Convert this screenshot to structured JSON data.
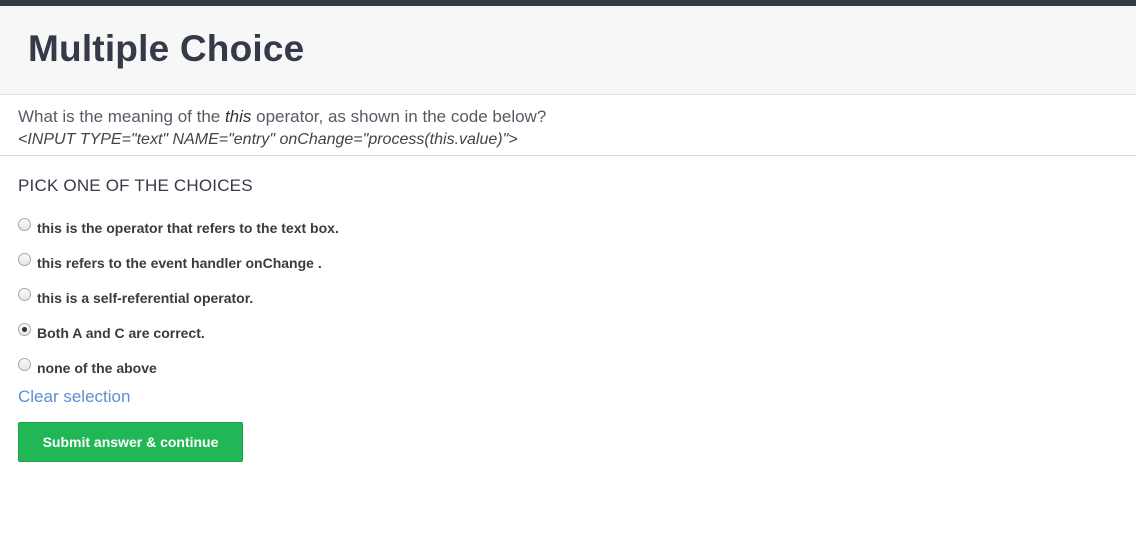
{
  "header": {
    "title": "Multiple Choice"
  },
  "question": {
    "prefix": "What is the meaning of the ",
    "emphasis": "this",
    "suffix": " operator, as shown in the code below?",
    "code": "<INPUT TYPE=\"text\" NAME=\"entry\" onChange=\"process(this.value)\">"
  },
  "choices": {
    "title": "PICK ONE OF THE CHOICES",
    "options": [
      {
        "label": "this is the operator that refers to the text box.",
        "selected": false
      },
      {
        "label": "this refers to the event handler onChange .",
        "selected": false
      },
      {
        "label": "this is a self-referential operator.",
        "selected": false
      },
      {
        "label": "Both A and C are correct.",
        "selected": true
      },
      {
        "label": "none of the above",
        "selected": false
      }
    ],
    "clear_label": "Clear selection",
    "submit_label": "Submit answer & continue"
  },
  "colors": {
    "header_bar": "#343a47",
    "submit_green": "#21b656",
    "link_blue": "#5b8fd6"
  }
}
